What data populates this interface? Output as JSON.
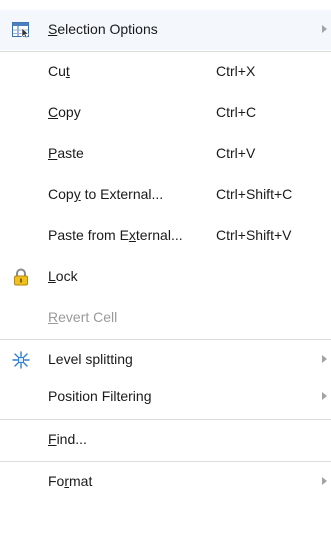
{
  "menu": {
    "items": [
      {
        "pre": "",
        "mn": "S",
        "post": "election Options",
        "shortcut": "",
        "submenu": true,
        "icon": "selection-options-icon"
      },
      {
        "pre": "Cu",
        "mn": "t",
        "post": "",
        "shortcut": "Ctrl+X"
      },
      {
        "pre": "",
        "mn": "C",
        "post": "opy",
        "shortcut": "Ctrl+C"
      },
      {
        "pre": "",
        "mn": "P",
        "post": "aste",
        "shortcut": "Ctrl+V"
      },
      {
        "pre": "Cop",
        "mn": "y",
        "post": " to External...",
        "shortcut": "Ctrl+Shift+C"
      },
      {
        "pre": "Paste from E",
        "mn": "x",
        "post": "ternal...",
        "shortcut": "Ctrl+Shift+V"
      },
      {
        "pre": "",
        "mn": "L",
        "post": "ock",
        "shortcut": "",
        "icon": "lock-icon"
      },
      {
        "pre": "",
        "mn": "R",
        "post": "evert Cell",
        "shortcut": "",
        "disabled": true
      },
      {
        "pre": "Level splitting",
        "mn": "",
        "post": "",
        "shortcut": "",
        "submenu": true,
        "icon": "level-splitting-icon"
      },
      {
        "pre": "Position Filtering",
        "mn": "",
        "post": "",
        "shortcut": "",
        "submenu": true
      },
      {
        "pre": "",
        "mn": "F",
        "post": "ind...",
        "shortcut": ""
      },
      {
        "pre": "Fo",
        "mn": "r",
        "post": "mat",
        "shortcut": "",
        "submenu": true
      }
    ]
  },
  "colors": {
    "text": "#1a1a1a",
    "disabled_text": "#9a9a9a",
    "separator": "#dcdcdc",
    "submenu_arrow": "#a3a3a3",
    "highlight_bg": "#f4f7fb",
    "lock_body": "#e8b400"
  }
}
